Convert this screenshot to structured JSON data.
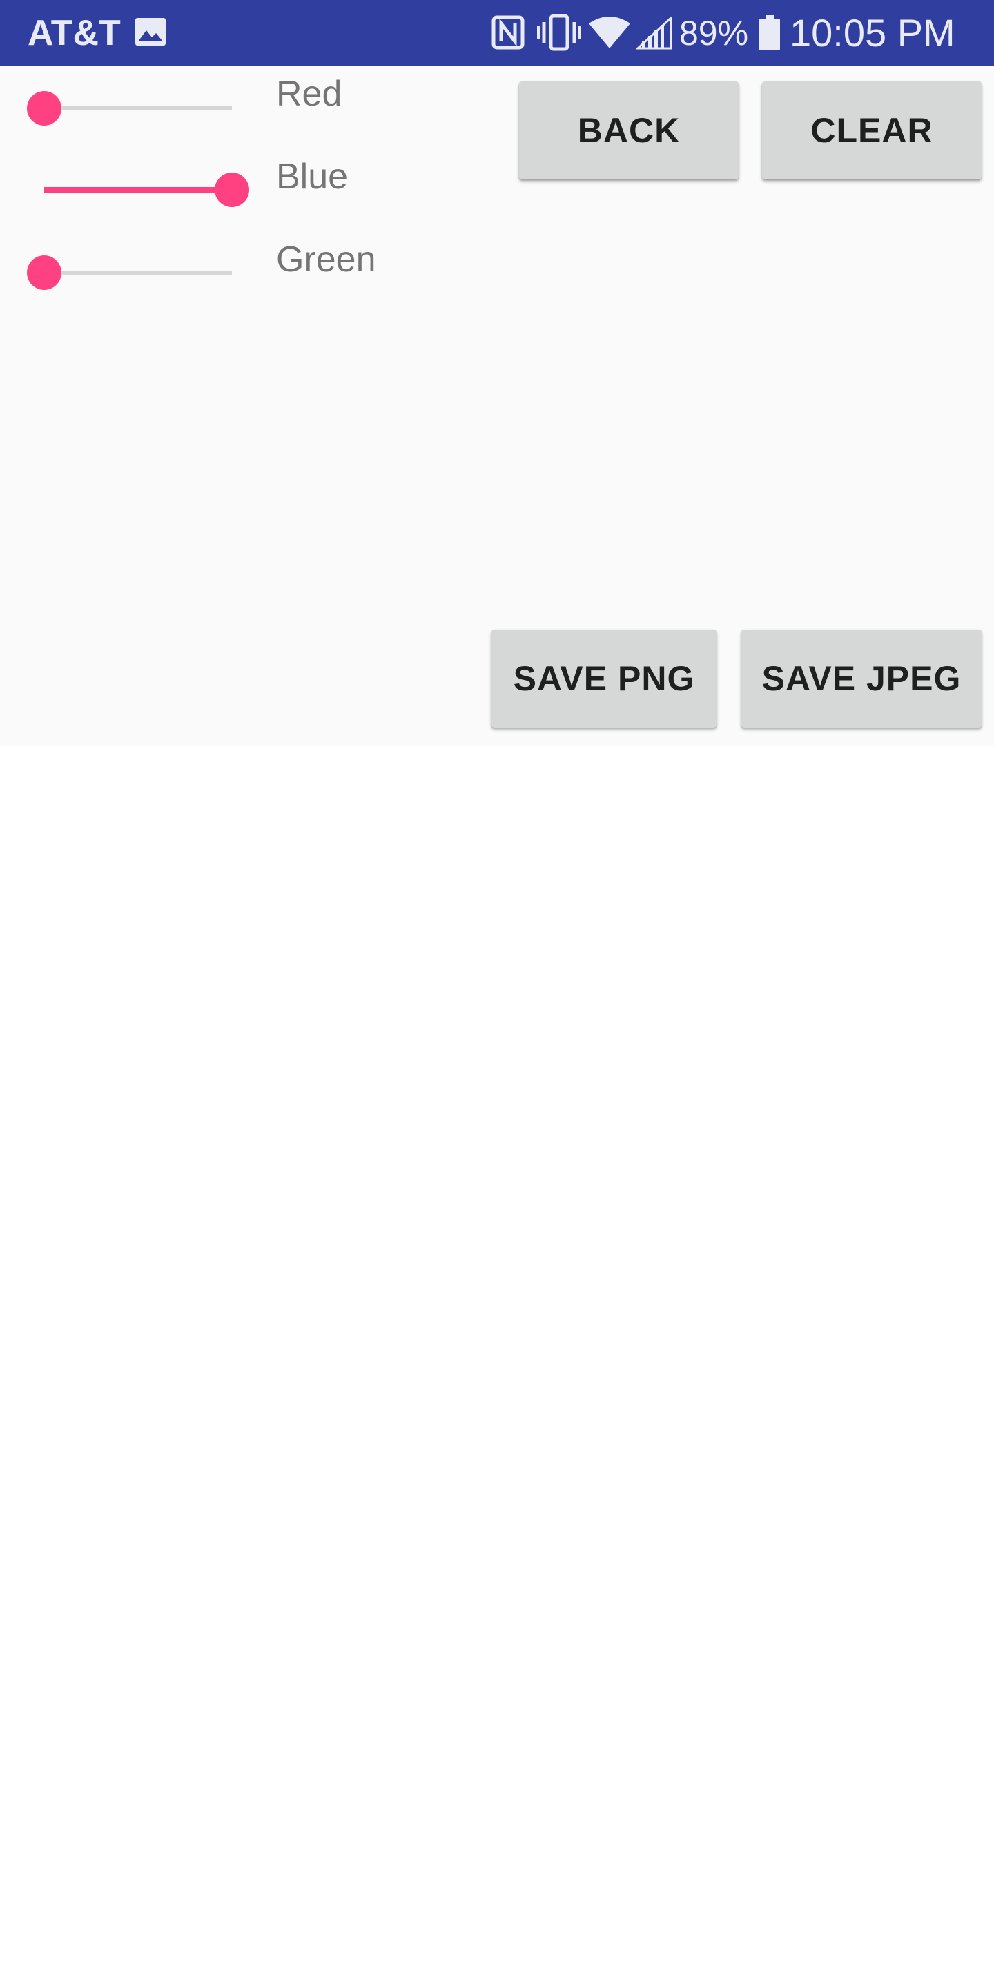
{
  "status_bar": {
    "carrier": "AT&T",
    "battery_percent": "89%",
    "time": "10:05 PM",
    "icons": [
      "gallery-icon",
      "nfc-icon",
      "vibrate-icon",
      "wifi-icon",
      "signal-icon",
      "battery-icon"
    ]
  },
  "sliders": [
    {
      "label": "Red",
      "value": 0.0
    },
    {
      "label": "Blue",
      "value": 1.0
    },
    {
      "label": "Green",
      "value": 0.0
    }
  ],
  "buttons": {
    "back": "BACK",
    "clear": "CLEAR",
    "save_png": "SAVE PNG",
    "save_jpeg": "SAVE JPEG"
  },
  "colors": {
    "status_bar": "#303F9F",
    "accent": "#FF4081",
    "button_bg": "#D6D7D7",
    "content_bg": "#FAFAFA"
  }
}
